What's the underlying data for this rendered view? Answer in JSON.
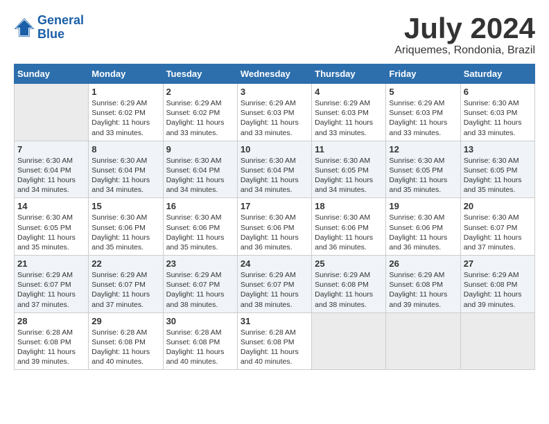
{
  "header": {
    "logo_line1": "General",
    "logo_line2": "Blue",
    "month": "July 2024",
    "location": "Ariquemes, Rondonia, Brazil"
  },
  "weekdays": [
    "Sunday",
    "Monday",
    "Tuesday",
    "Wednesday",
    "Thursday",
    "Friday",
    "Saturday"
  ],
  "weeks": [
    [
      {
        "day": "",
        "detail": ""
      },
      {
        "day": "1",
        "detail": "Sunrise: 6:29 AM\nSunset: 6:02 PM\nDaylight: 11 hours\nand 33 minutes."
      },
      {
        "day": "2",
        "detail": "Sunrise: 6:29 AM\nSunset: 6:02 PM\nDaylight: 11 hours\nand 33 minutes."
      },
      {
        "day": "3",
        "detail": "Sunrise: 6:29 AM\nSunset: 6:03 PM\nDaylight: 11 hours\nand 33 minutes."
      },
      {
        "day": "4",
        "detail": "Sunrise: 6:29 AM\nSunset: 6:03 PM\nDaylight: 11 hours\nand 33 minutes."
      },
      {
        "day": "5",
        "detail": "Sunrise: 6:29 AM\nSunset: 6:03 PM\nDaylight: 11 hours\nand 33 minutes."
      },
      {
        "day": "6",
        "detail": "Sunrise: 6:30 AM\nSunset: 6:03 PM\nDaylight: 11 hours\nand 33 minutes."
      }
    ],
    [
      {
        "day": "7",
        "detail": "Sunrise: 6:30 AM\nSunset: 6:04 PM\nDaylight: 11 hours\nand 34 minutes."
      },
      {
        "day": "8",
        "detail": "Sunrise: 6:30 AM\nSunset: 6:04 PM\nDaylight: 11 hours\nand 34 minutes."
      },
      {
        "day": "9",
        "detail": "Sunrise: 6:30 AM\nSunset: 6:04 PM\nDaylight: 11 hours\nand 34 minutes."
      },
      {
        "day": "10",
        "detail": "Sunrise: 6:30 AM\nSunset: 6:04 PM\nDaylight: 11 hours\nand 34 minutes."
      },
      {
        "day": "11",
        "detail": "Sunrise: 6:30 AM\nSunset: 6:05 PM\nDaylight: 11 hours\nand 34 minutes."
      },
      {
        "day": "12",
        "detail": "Sunrise: 6:30 AM\nSunset: 6:05 PM\nDaylight: 11 hours\nand 35 minutes."
      },
      {
        "day": "13",
        "detail": "Sunrise: 6:30 AM\nSunset: 6:05 PM\nDaylight: 11 hours\nand 35 minutes."
      }
    ],
    [
      {
        "day": "14",
        "detail": "Sunrise: 6:30 AM\nSunset: 6:05 PM\nDaylight: 11 hours\nand 35 minutes."
      },
      {
        "day": "15",
        "detail": "Sunrise: 6:30 AM\nSunset: 6:06 PM\nDaylight: 11 hours\nand 35 minutes."
      },
      {
        "day": "16",
        "detail": "Sunrise: 6:30 AM\nSunset: 6:06 PM\nDaylight: 11 hours\nand 35 minutes."
      },
      {
        "day": "17",
        "detail": "Sunrise: 6:30 AM\nSunset: 6:06 PM\nDaylight: 11 hours\nand 36 minutes."
      },
      {
        "day": "18",
        "detail": "Sunrise: 6:30 AM\nSunset: 6:06 PM\nDaylight: 11 hours\nand 36 minutes."
      },
      {
        "day": "19",
        "detail": "Sunrise: 6:30 AM\nSunset: 6:06 PM\nDaylight: 11 hours\nand 36 minutes."
      },
      {
        "day": "20",
        "detail": "Sunrise: 6:30 AM\nSunset: 6:07 PM\nDaylight: 11 hours\nand 37 minutes."
      }
    ],
    [
      {
        "day": "21",
        "detail": "Sunrise: 6:29 AM\nSunset: 6:07 PM\nDaylight: 11 hours\nand 37 minutes."
      },
      {
        "day": "22",
        "detail": "Sunrise: 6:29 AM\nSunset: 6:07 PM\nDaylight: 11 hours\nand 37 minutes."
      },
      {
        "day": "23",
        "detail": "Sunrise: 6:29 AM\nSunset: 6:07 PM\nDaylight: 11 hours\nand 38 minutes."
      },
      {
        "day": "24",
        "detail": "Sunrise: 6:29 AM\nSunset: 6:07 PM\nDaylight: 11 hours\nand 38 minutes."
      },
      {
        "day": "25",
        "detail": "Sunrise: 6:29 AM\nSunset: 6:08 PM\nDaylight: 11 hours\nand 38 minutes."
      },
      {
        "day": "26",
        "detail": "Sunrise: 6:29 AM\nSunset: 6:08 PM\nDaylight: 11 hours\nand 39 minutes."
      },
      {
        "day": "27",
        "detail": "Sunrise: 6:29 AM\nSunset: 6:08 PM\nDaylight: 11 hours\nand 39 minutes."
      }
    ],
    [
      {
        "day": "28",
        "detail": "Sunrise: 6:28 AM\nSunset: 6:08 PM\nDaylight: 11 hours\nand 39 minutes."
      },
      {
        "day": "29",
        "detail": "Sunrise: 6:28 AM\nSunset: 6:08 PM\nDaylight: 11 hours\nand 40 minutes."
      },
      {
        "day": "30",
        "detail": "Sunrise: 6:28 AM\nSunset: 6:08 PM\nDaylight: 11 hours\nand 40 minutes."
      },
      {
        "day": "31",
        "detail": "Sunrise: 6:28 AM\nSunset: 6:08 PM\nDaylight: 11 hours\nand 40 minutes."
      },
      {
        "day": "",
        "detail": ""
      },
      {
        "day": "",
        "detail": ""
      },
      {
        "day": "",
        "detail": ""
      }
    ]
  ]
}
